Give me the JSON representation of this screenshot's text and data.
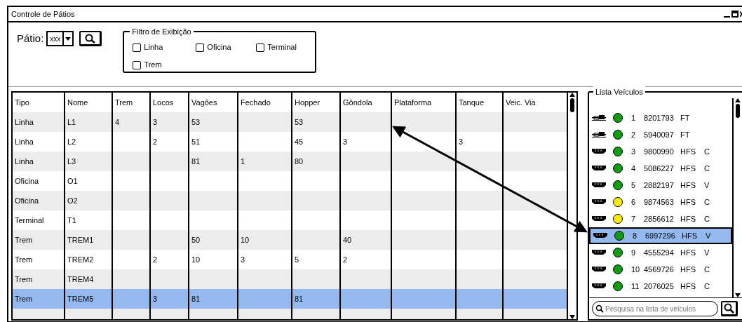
{
  "window": {
    "title": "Controle de Pátios"
  },
  "yard": {
    "label": "Pátio:",
    "value": "xxx"
  },
  "filter": {
    "title": "Filtro de Exibição",
    "options": [
      {
        "label": "Linha",
        "checked": false
      },
      {
        "label": "Oficina",
        "checked": false
      },
      {
        "label": "Terminal",
        "checked": false
      },
      {
        "label": "Trem",
        "checked": false
      }
    ]
  },
  "table": {
    "columns": [
      "Tipo",
      "Nome",
      "Trem",
      "Locos",
      "Vagões",
      "Fechado",
      "Hopper",
      "Gôndola",
      "Plataforma",
      "Tanque",
      "Veic. Via"
    ],
    "rows": [
      {
        "selected": false,
        "cells": [
          "Linha",
          "L1",
          "4",
          "3",
          "53",
          null,
          "53",
          null,
          null,
          null,
          null
        ]
      },
      {
        "selected": false,
        "cells": [
          "Linha",
          "L2",
          null,
          "2",
          "51",
          null,
          "45",
          "3",
          null,
          "3",
          null
        ]
      },
      {
        "selected": false,
        "cells": [
          "Linha",
          "L3",
          null,
          null,
          "81",
          "1",
          "80",
          null,
          null,
          null,
          null
        ]
      },
      {
        "selected": false,
        "cells": [
          "Oficina",
          "O1",
          null,
          null,
          null,
          null,
          null,
          null,
          null,
          null,
          null
        ]
      },
      {
        "selected": false,
        "cells": [
          "Oficina",
          "O2",
          null,
          null,
          null,
          null,
          null,
          null,
          null,
          null,
          null
        ]
      },
      {
        "selected": false,
        "cells": [
          "Terminal",
          "T1",
          null,
          null,
          null,
          null,
          null,
          null,
          null,
          null,
          null
        ]
      },
      {
        "selected": false,
        "cells": [
          "Trem",
          "TREM1",
          null,
          null,
          "50",
          "10",
          null,
          "40",
          null,
          null,
          null
        ]
      },
      {
        "selected": false,
        "cells": [
          "Trem",
          "TREM2",
          null,
          "2",
          "10",
          "3",
          "5",
          "2",
          null,
          null,
          null
        ]
      },
      {
        "selected": false,
        "cells": [
          "Trem",
          "TREM4",
          null,
          null,
          null,
          null,
          null,
          null,
          null,
          null,
          null
        ]
      },
      {
        "selected": true,
        "cells": [
          "Trem",
          "TREM5",
          null,
          "3",
          "81",
          null,
          "81",
          null,
          null,
          null,
          null
        ]
      }
    ]
  },
  "vehicle_list": {
    "title": "Lista Veículos",
    "items": [
      {
        "kind": "locomotive",
        "color": "#109c10",
        "selected": false,
        "number": "1",
        "code": "8201793",
        "type": "FT"
      },
      {
        "kind": "locomotive",
        "color": "#109c10",
        "selected": false,
        "number": "2",
        "code": "5940097",
        "type": "FT"
      },
      {
        "kind": "wagon",
        "color": "#109c10",
        "selected": false,
        "number": "3",
        "code": "9800990",
        "type": "HFS",
        "load": "C"
      },
      {
        "kind": "wagon",
        "color": "#109c10",
        "selected": false,
        "number": "4",
        "code": "5086227",
        "type": "HFS",
        "load": "C"
      },
      {
        "kind": "wagon",
        "color": "#109c10",
        "selected": false,
        "number": "5",
        "code": "2882197",
        "type": "HFS",
        "load": "V"
      },
      {
        "kind": "wagon",
        "color": "#ffee00",
        "selected": false,
        "number": "6",
        "code": "9874563",
        "type": "HFS",
        "load": "C"
      },
      {
        "kind": "wagon",
        "color": "#ffee00",
        "selected": false,
        "number": "7",
        "code": "2856612",
        "type": "HFS",
        "load": "C"
      },
      {
        "kind": "wagon",
        "color": "#109c10",
        "selected": true,
        "number": "8",
        "code": "6997296",
        "type": "HFS",
        "load": "V"
      },
      {
        "kind": "wagon",
        "color": "#109c10",
        "selected": false,
        "number": "9",
        "code": "4555294",
        "type": "HFS",
        "load": "V"
      },
      {
        "kind": "wagon",
        "color": "#109c10",
        "selected": false,
        "number": "10",
        "code": "4569726",
        "type": "HFS",
        "load": "C"
      },
      {
        "kind": "wagon",
        "color": "#109c10",
        "selected": false,
        "number": "11",
        "code": "2076025",
        "type": "HFS",
        "load": "C"
      }
    ],
    "search": {
      "placeholder": "Pesquisa na lista de veículos"
    }
  }
}
